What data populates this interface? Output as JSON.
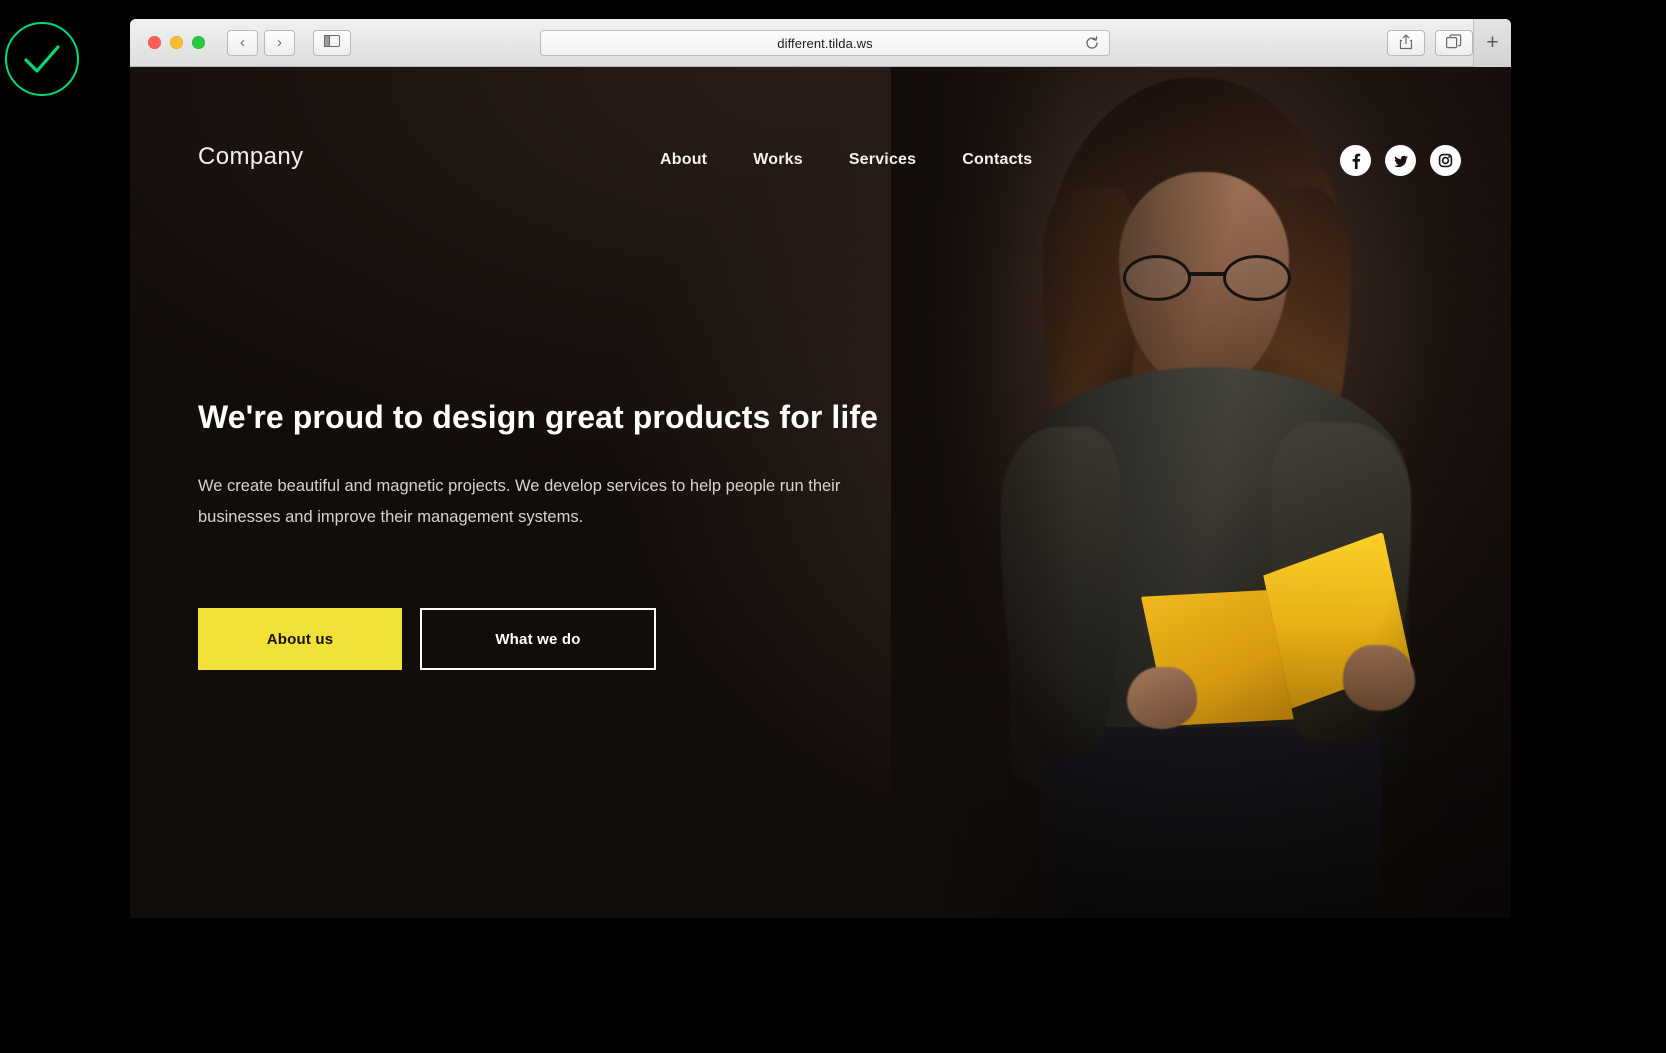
{
  "badge": {
    "name": "success-check",
    "color": "#00d977"
  },
  "browser": {
    "traffic_lights": [
      "close",
      "minimize",
      "zoom"
    ],
    "back_label": "‹",
    "forward_label": "›",
    "sidebar_label": "sidebar",
    "url": "different.tilda.ws",
    "reload_label": "↻",
    "share_label": "share",
    "tabs_label": "tabs",
    "new_tab_label": "+"
  },
  "site": {
    "logo": "Company",
    "nav": [
      {
        "label": "About"
      },
      {
        "label": "Works"
      },
      {
        "label": "Services"
      },
      {
        "label": "Contacts"
      }
    ],
    "socials": [
      {
        "name": "facebook",
        "glyph": "f"
      },
      {
        "name": "twitter",
        "glyph": "t"
      },
      {
        "name": "instagram",
        "glyph": "i"
      }
    ],
    "hero": {
      "heading": "We're proud to design great products for life",
      "paragraph": "We create beautiful and magnetic projects. We develop services to help people run their businesses and improve their management systems.",
      "primary_button": "About us",
      "secondary_button": "What we do"
    },
    "colors": {
      "accent_yellow": "#f2e139",
      "background": "#130d0a",
      "text": "#ffffff"
    },
    "hero_image_alt": "Woman wearing glasses reading a yellow book in dark room"
  }
}
